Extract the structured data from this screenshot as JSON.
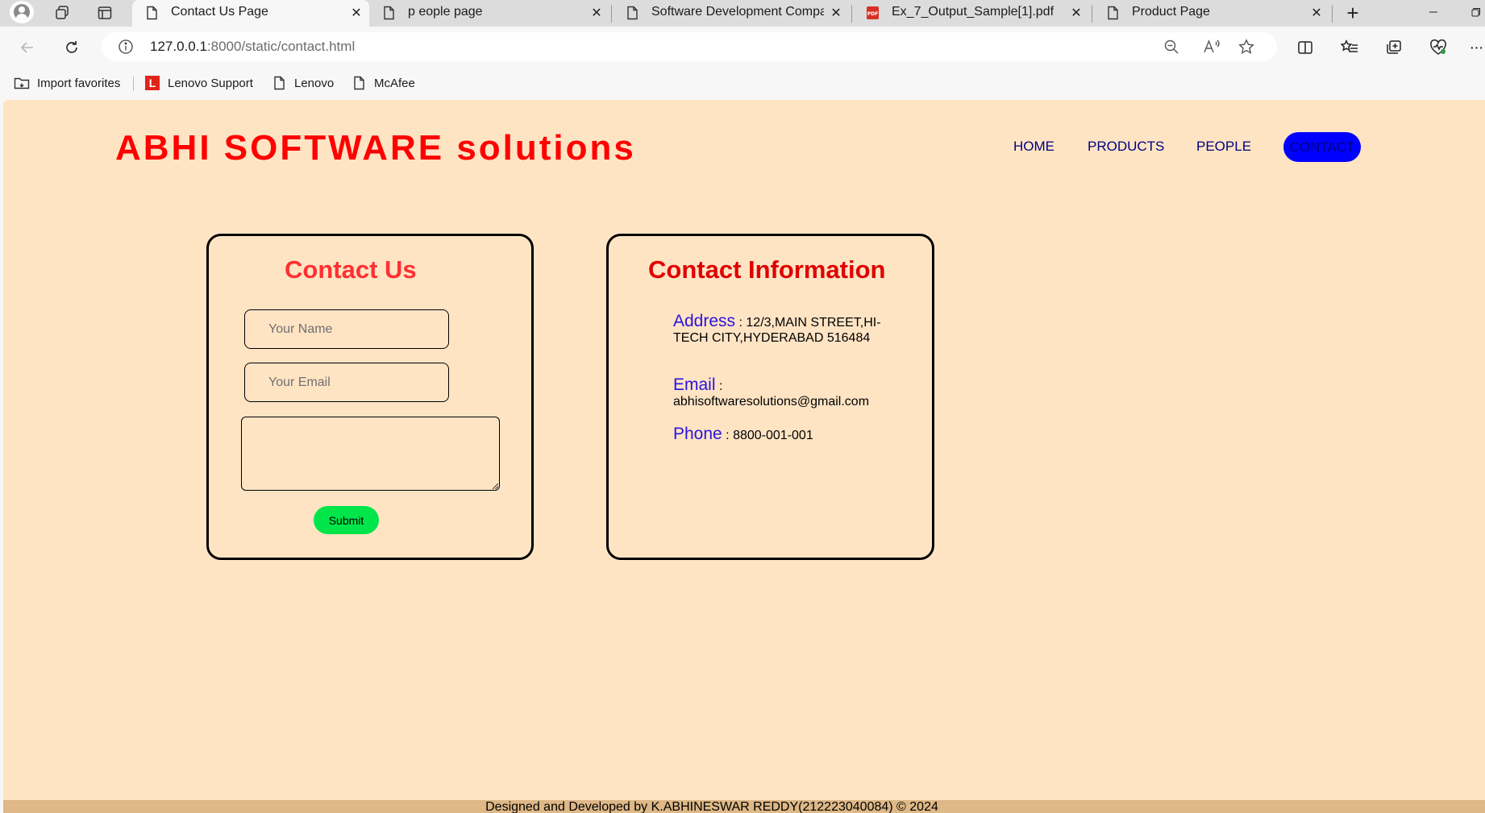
{
  "browser": {
    "tabs": [
      {
        "title": "Contact Us Page",
        "active": true,
        "icon": "page-icon"
      },
      {
        "title": "p eople page",
        "active": false,
        "icon": "page-icon"
      },
      {
        "title": "Software Development Company",
        "active": false,
        "icon": "page-icon"
      },
      {
        "title": "Ex_7_Output_Sample[1].pdf",
        "active": false,
        "icon": "pdf-icon"
      },
      {
        "title": "Product Page",
        "active": false,
        "icon": "page-icon"
      }
    ],
    "address_bar": {
      "host": "127.0.0.1",
      "path": ":8000/static/contact.html"
    },
    "favorites": [
      {
        "label": "Import favorites",
        "icon": "import-favorites-icon"
      },
      {
        "label": "Lenovo Support",
        "icon": "lenovo-logo-icon",
        "badge": "L"
      },
      {
        "label": "Lenovo",
        "icon": "page-icon"
      },
      {
        "label": "McAfee",
        "icon": "page-icon"
      }
    ]
  },
  "site": {
    "logo": "ABHI SOFTWARE solutions",
    "nav": {
      "home": "HOME",
      "products": "PRODUCTS",
      "people": "PEOPLE",
      "contact": "CONTACT"
    },
    "contact_form": {
      "title": "Contact Us",
      "name_placeholder": "Your Name",
      "email_placeholder": "Your Email",
      "submit": "Submit"
    },
    "contact_info": {
      "title": "Contact Information",
      "address_label": "Address",
      "address_value": "12/3,MAIN STREET,HI-TECH CITY,HYDERABAD 516484",
      "email_label": "Email",
      "email_value": "abhisoftwaresolutions@gmail.com",
      "phone_label": "Phone",
      "phone_value": "8800-001-001",
      "separator": " : "
    },
    "footer": "Designed and Developed by K.ABHINESWAR REDDY(212223040084) © 2024"
  },
  "colors": {
    "page_bg": "#ffe4c4",
    "logo": "#ff0000",
    "nav_text": "#000080",
    "contact_pill": "#0000ff",
    "submit_bg": "#00e64a",
    "info_label": "#2a12e0",
    "footer_bg": "#deb887"
  }
}
